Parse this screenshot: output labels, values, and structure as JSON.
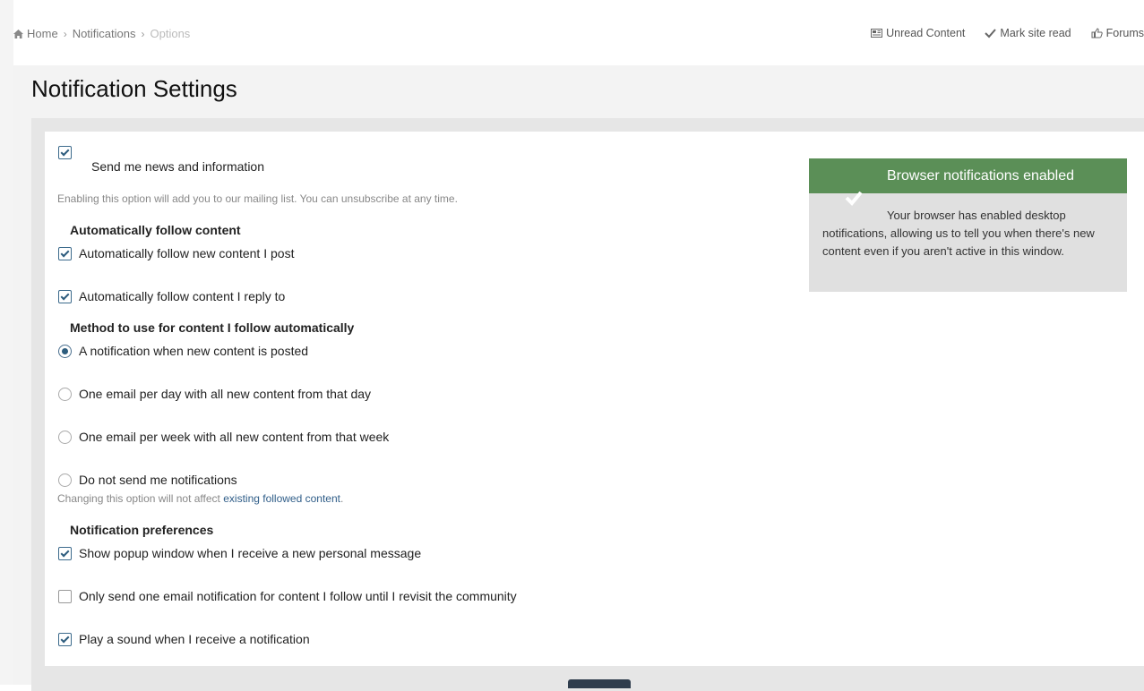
{
  "breadcrumb": {
    "items": [
      "Home",
      "Notifications",
      "Options"
    ]
  },
  "top_actions": {
    "unread": "Unread Content",
    "mark_read": "Mark site read",
    "forums": "Forums"
  },
  "page_title": "Notification Settings",
  "news": {
    "label": "Send me news and information",
    "checked": true,
    "hint": "Enabling this option will add you to our mailing list. You can unsubscribe at any time."
  },
  "auto_follow": {
    "heading": "Automatically follow content",
    "options": [
      {
        "label": "Automatically follow new content I post",
        "checked": true
      },
      {
        "label": "Automatically follow content I reply to",
        "checked": true
      }
    ]
  },
  "method": {
    "heading": "Method to use for content I follow automatically",
    "options": [
      {
        "label": "A notification when new content is posted",
        "selected": true
      },
      {
        "label": "One email per day with all new content from that day",
        "selected": false
      },
      {
        "label": "One email per week with all new content from that week",
        "selected": false
      },
      {
        "label": "Do not send me notifications",
        "selected": false
      }
    ],
    "hint_prefix": "Changing this option will not affect ",
    "hint_link": "existing followed content",
    "hint_suffix": "."
  },
  "preferences": {
    "heading": "Notification preferences",
    "options": [
      {
        "label": "Show popup window when I receive a new personal message",
        "checked": true
      },
      {
        "label": "Only send one email notification for content I follow until I revisit the community",
        "checked": false
      },
      {
        "label": "Play a sound when I receive a notification",
        "checked": true
      }
    ]
  },
  "browser_notifications": {
    "title": "Browser notifications enabled",
    "body": "Your browser has enabled desktop notifications, allowing us to tell you when there's new content even if you aren't active in this window.",
    "header_color": "#5b8f57"
  }
}
